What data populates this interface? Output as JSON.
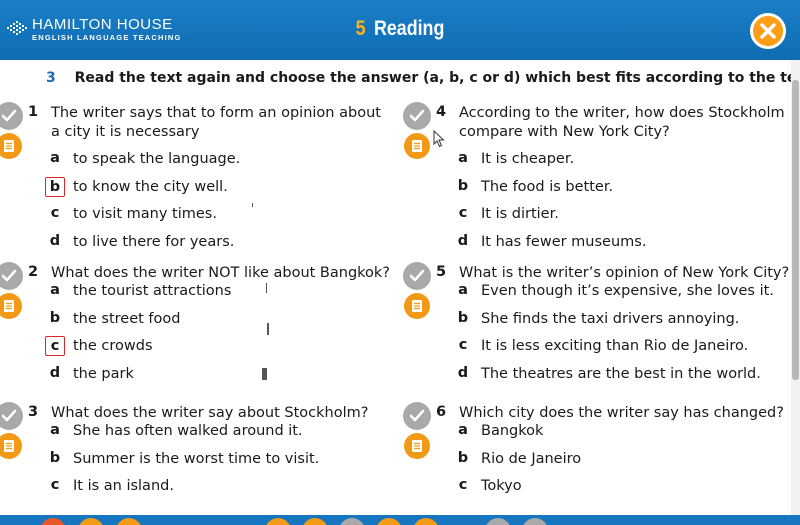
{
  "header": {
    "brand_name": "HAMILTON HOUSE",
    "brand_sub": "ENGLISH LANGUAGE TEACHING",
    "unit_number": "5",
    "unit_title": "Reading",
    "colors": {
      "bar": "#1676c0",
      "accent": "#ffb11a",
      "close": "#ff9d15"
    }
  },
  "exercise": {
    "number": "3",
    "instruction": "Read the text again and choose the answer (a, b, c or d) which best fits according to the text."
  },
  "questions": [
    {
      "num": "1",
      "lines": [
        "The writer says that to form an opinion about",
        "a city it is necessary"
      ],
      "options": [
        {
          "letter": "a",
          "text": "to speak the language."
        },
        {
          "letter": "b",
          "text": "to know the city well.",
          "selected": true
        },
        {
          "letter": "c",
          "text": "to visit many times."
        },
        {
          "letter": "d",
          "text": "to live there for years."
        }
      ]
    },
    {
      "num": "2",
      "lines": [
        "What does the writer NOT like about Bangkok?"
      ],
      "options": [
        {
          "letter": "a",
          "text": "the tourist attractions"
        },
        {
          "letter": "b",
          "text": "the street food"
        },
        {
          "letter": "c",
          "text": "the crowds",
          "selected": true
        },
        {
          "letter": "d",
          "text": "the park"
        }
      ]
    },
    {
      "num": "3",
      "lines": [
        "What does the writer say about Stockholm?"
      ],
      "options": [
        {
          "letter": "a",
          "text": "She has often walked around it."
        },
        {
          "letter": "b",
          "text": "Summer is the worst time to visit."
        },
        {
          "letter": "c",
          "text": "It is an island."
        }
      ]
    },
    {
      "num": "4",
      "lines": [
        "According to the writer, how does Stockholm",
        "compare with New York City?"
      ],
      "options": [
        {
          "letter": "a",
          "text": "It is cheaper."
        },
        {
          "letter": "b",
          "text": "The food is better."
        },
        {
          "letter": "c",
          "text": "It is dirtier."
        },
        {
          "letter": "d",
          "text": "It has fewer museums."
        }
      ]
    },
    {
      "num": "5",
      "lines": [
        "What is the writer’s opinion of New York City?"
      ],
      "options": [
        {
          "letter": "a",
          "text": "Even though it’s expensive, she loves it."
        },
        {
          "letter": "b",
          "text": "She finds the taxi drivers annoying."
        },
        {
          "letter": "c",
          "text": "It is less exciting than Rio de Janeiro."
        },
        {
          "letter": "d",
          "text": "The theatres are the best in the world."
        }
      ]
    },
    {
      "num": "6",
      "lines": [
        "Which city does the writer say has changed?"
      ],
      "options": [
        {
          "letter": "a",
          "text": "Bangkok"
        },
        {
          "letter": "b",
          "text": "Rio de Janeiro"
        },
        {
          "letter": "c",
          "text": "Tokyo"
        }
      ]
    }
  ],
  "icons": {
    "check": "check-icon",
    "notes": "notes-icon",
    "close": "close-icon"
  }
}
